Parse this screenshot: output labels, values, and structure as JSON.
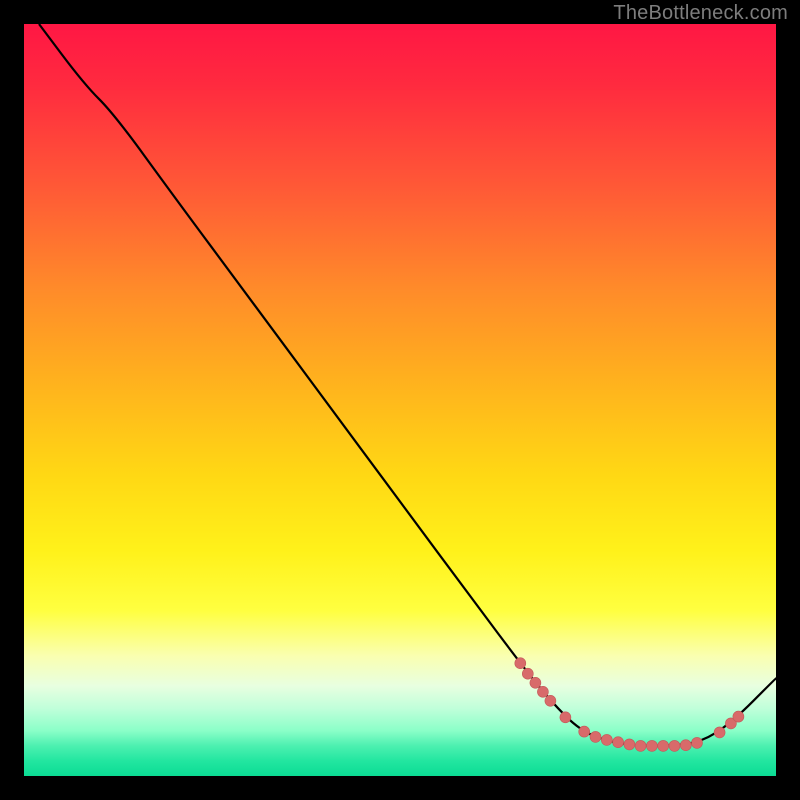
{
  "watermark": "TheBottleneck.com",
  "chart_data": {
    "type": "line",
    "title": "",
    "xlabel": "",
    "ylabel": "",
    "xlim": [
      0,
      100
    ],
    "ylim": [
      0,
      100
    ],
    "background_gradient": {
      "top_color": "#ff1744",
      "bottom_color": "#0bdc94",
      "description": "vertical gradient red → orange → yellow → pale → green"
    },
    "curve": {
      "description": "bottleneck curve: starts near 100 at x≈2, slight bend around x≈10, near-linear descent to a flat minimum ~y=4 over x≈75–90, then rises to ~y=13 at x=100",
      "points": [
        {
          "x": 2,
          "y": 100
        },
        {
          "x": 8,
          "y": 92
        },
        {
          "x": 12,
          "y": 88
        },
        {
          "x": 20,
          "y": 77
        },
        {
          "x": 30,
          "y": 63.5
        },
        {
          "x": 40,
          "y": 50
        },
        {
          "x": 50,
          "y": 36.5
        },
        {
          "x": 60,
          "y": 23
        },
        {
          "x": 66,
          "y": 15
        },
        {
          "x": 70,
          "y": 10
        },
        {
          "x": 74,
          "y": 6
        },
        {
          "x": 78,
          "y": 4.5
        },
        {
          "x": 82,
          "y": 4
        },
        {
          "x": 86,
          "y": 4
        },
        {
          "x": 90,
          "y": 4.5
        },
        {
          "x": 94,
          "y": 7
        },
        {
          "x": 100,
          "y": 13
        }
      ]
    },
    "marker_cluster": {
      "description": "salmon-colored points clustered along the curve near the minimum",
      "points": [
        {
          "x": 66.0,
          "y": 15.0
        },
        {
          "x": 67.0,
          "y": 13.6
        },
        {
          "x": 68.0,
          "y": 12.4
        },
        {
          "x": 69.0,
          "y": 11.2
        },
        {
          "x": 70.0,
          "y": 10.0
        },
        {
          "x": 72.0,
          "y": 7.8
        },
        {
          "x": 74.5,
          "y": 5.9
        },
        {
          "x": 76.0,
          "y": 5.2
        },
        {
          "x": 77.5,
          "y": 4.8
        },
        {
          "x": 79.0,
          "y": 4.5
        },
        {
          "x": 80.5,
          "y": 4.2
        },
        {
          "x": 82.0,
          "y": 4.0
        },
        {
          "x": 83.5,
          "y": 4.0
        },
        {
          "x": 85.0,
          "y": 4.0
        },
        {
          "x": 86.5,
          "y": 4.0
        },
        {
          "x": 88.0,
          "y": 4.1
        },
        {
          "x": 89.5,
          "y": 4.4
        },
        {
          "x": 92.5,
          "y": 5.8
        },
        {
          "x": 94.0,
          "y": 7.0
        },
        {
          "x": 95.0,
          "y": 7.9
        }
      ]
    }
  }
}
